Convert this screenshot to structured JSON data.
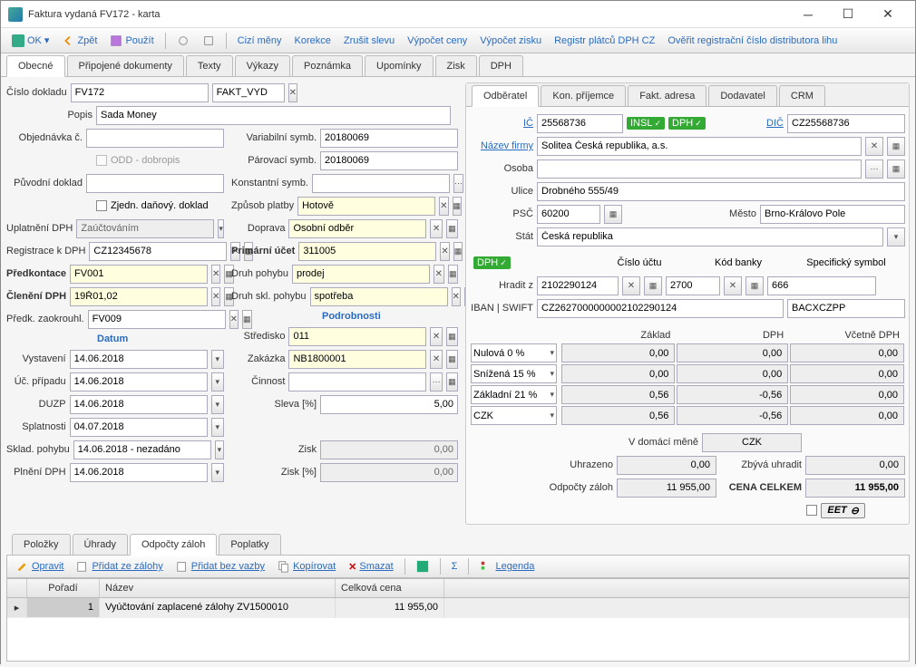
{
  "window": {
    "title": "Faktura vydaná FV172 - karta"
  },
  "toolbar": {
    "ok": "OK",
    "zpet": "Zpět",
    "pouzit": "Použít",
    "cizi_meny": "Cizí měny",
    "korekce": "Korekce",
    "zrusit_slevu": "Zrušit slevu",
    "vypocet_ceny": "Výpočet ceny",
    "vypocet_zisku": "Výpočet zisku",
    "registr": "Registr plátců DPH CZ",
    "overit": "Ověřit registrační číslo distributora lihu"
  },
  "main_tabs": [
    "Obecné",
    "Připojené dokumenty",
    "Texty",
    "Výkazy",
    "Poznámka",
    "Upomínky",
    "Zisk",
    "DPH"
  ],
  "left": {
    "cislo_dokladu_lbl": "Číslo dokladu",
    "cislo_dokladu": "FV172",
    "typ": "FAKT_VYD",
    "popis_lbl": "Popis",
    "popis": "Sada Money",
    "objednavka_lbl": "Objednávka č.",
    "objednavka": "",
    "odd_lbl": "ODD - dobropis",
    "puvodni_lbl": "Původní doklad",
    "puvodni": "",
    "zjedn_lbl": "Zjedn. daňový. doklad",
    "uplatneni_lbl": "Uplatnění DPH",
    "uplatneni": "Zaúčtováním",
    "registrace_lbl": "Registrace k DPH",
    "registrace": "CZ12345678",
    "predkontace_lbl": "Předkontace",
    "predkontace": "FV001",
    "cleneni_lbl": "Členění DPH",
    "cleneni": "19Ř01,02",
    "zaokrouhl_lbl": "Předk. zaokrouhl.",
    "zaokrouhl": "FV009",
    "datum_header": "Datum",
    "vystaveni_lbl": "Vystavení",
    "vystaveni": "14.06.2018",
    "uc_pripadu_lbl": "Úč. případu",
    "uc_pripadu": "14.06.2018",
    "duzp_lbl": "DUZP",
    "duzp": "14.06.2018",
    "splatnosti_lbl": "Splatnosti",
    "splatnosti": "04.07.2018",
    "sklad_pohybu_lbl": "Sklad. pohybu",
    "sklad_pohybu": "14.06.2018 - nezadáno",
    "plneni_lbl": "Plnění DPH",
    "plneni": "14.06.2018"
  },
  "mid": {
    "var_symb_lbl": "Variabilní symb.",
    "var_symb": "20180069",
    "par_symb_lbl": "Párovací symb.",
    "par_symb": "20180069",
    "konst_symb_lbl": "Konstantní symb.",
    "konst_symb": "",
    "zpusob_lbl": "Způsob platby",
    "zpusob": "Hotově",
    "doprava_lbl": "Doprava",
    "doprava": "Osobní odběr",
    "primarni_lbl": "Primární účet",
    "primarni": "311005",
    "druh_pohybu_lbl": "Druh pohybu",
    "druh_pohybu": "prodej",
    "druh_skl_lbl": "Druh skl. pohybu",
    "druh_skl": "spotřeba",
    "podrobnosti_header": "Podrobnosti",
    "stredisko_lbl": "Středisko",
    "stredisko": "011",
    "zakazka_lbl": "Zakázka",
    "zakazka": "NB1800001",
    "cinnost_lbl": "Činnost",
    "cinnost": "",
    "sleva_lbl": "Sleva [%]",
    "sleva": "5,00",
    "zisk_lbl": "Zisk",
    "zisk": "0,00",
    "zisk_pct_lbl": "Zisk [%]",
    "zisk_pct": "0,00"
  },
  "right_tabs": [
    "Odběratel",
    "Kon. příjemce",
    "Fakt. adresa",
    "Dodavatel",
    "CRM"
  ],
  "customer": {
    "ic_lbl": "IČ",
    "ic": "25568736",
    "insl": "INSL",
    "dph_badge": "DPH",
    "dic_lbl": "DIČ",
    "dic": "CZ25568736",
    "nazev_lbl": "Název firmy",
    "nazev": "Solitea Česká republika, a.s.",
    "osoba_lbl": "Osoba",
    "osoba": "",
    "ulice_lbl": "Ulice",
    "ulice": "Drobného 555/49",
    "psc_lbl": "PSČ",
    "psc": "60200",
    "mesto_lbl": "Město",
    "mesto": "Brno-Královo Pole",
    "stat_lbl": "Stát",
    "stat": "Česká republika",
    "dph_on": "DPH",
    "cislo_uctu_lbl": "Číslo účtu",
    "kod_banky_lbl": "Kód banky",
    "spec_symbol_lbl": "Specifický symbol",
    "hradit_lbl": "Hradit z",
    "cislo_uctu": "2102290124",
    "kod_banky": "2700",
    "spec_symbol": "666",
    "iban_lbl": "IBAN | SWIFT",
    "iban": "CZ2627000000002102290124",
    "swift": "BACXCZPP"
  },
  "vat": {
    "zaklad_lbl": "Základ",
    "dph_lbl": "DPH",
    "vcetne_lbl": "Včetně DPH",
    "rows": [
      {
        "name": "Nulová 0 %",
        "zaklad": "0,00",
        "dph": "0,00",
        "vcetne": "0,00"
      },
      {
        "name": "Snížená 15 %",
        "zaklad": "0,00",
        "dph": "0,00",
        "vcetne": "0,00"
      },
      {
        "name": "Základní 21 %",
        "zaklad": "0,56",
        "dph": "-0,56",
        "vcetne": "0,00"
      }
    ],
    "currency": "CZK",
    "sum_zaklad": "0,56",
    "sum_dph": "-0,56",
    "sum_vcetne": "0,00",
    "domaci_lbl": "V domácí měně",
    "domaci": "CZK",
    "uhrazeno_lbl": "Uhrazeno",
    "uhrazeno": "0,00",
    "zbyva_lbl": "Zbývá uhradit",
    "zbyva": "0,00",
    "odpocty_lbl": "Odpočty záloh",
    "odpocty": "11 955,00",
    "celkem_lbl": "CENA CELKEM",
    "celkem": "11 955,00",
    "eet": "EET"
  },
  "bottom_tabs": [
    "Položky",
    "Úhrady",
    "Odpočty záloh",
    "Poplatky"
  ],
  "grid_toolbar": {
    "opravit": "Opravit",
    "pridat_zalohy": "Přidat ze zálohy",
    "pridat_bez": "Přidat bez vazby",
    "kopirovat": "Kopírovat",
    "smazat": "Smazat",
    "legenda": "Legenda"
  },
  "grid": {
    "headers": {
      "poradi": "Pořadí",
      "nazev": "Název",
      "cena": "Celková cena"
    },
    "rows": [
      {
        "poradi": "1",
        "nazev": "Vyúčtování zaplacené zálohy ZV1500010",
        "cena": "11 955,00"
      }
    ]
  }
}
